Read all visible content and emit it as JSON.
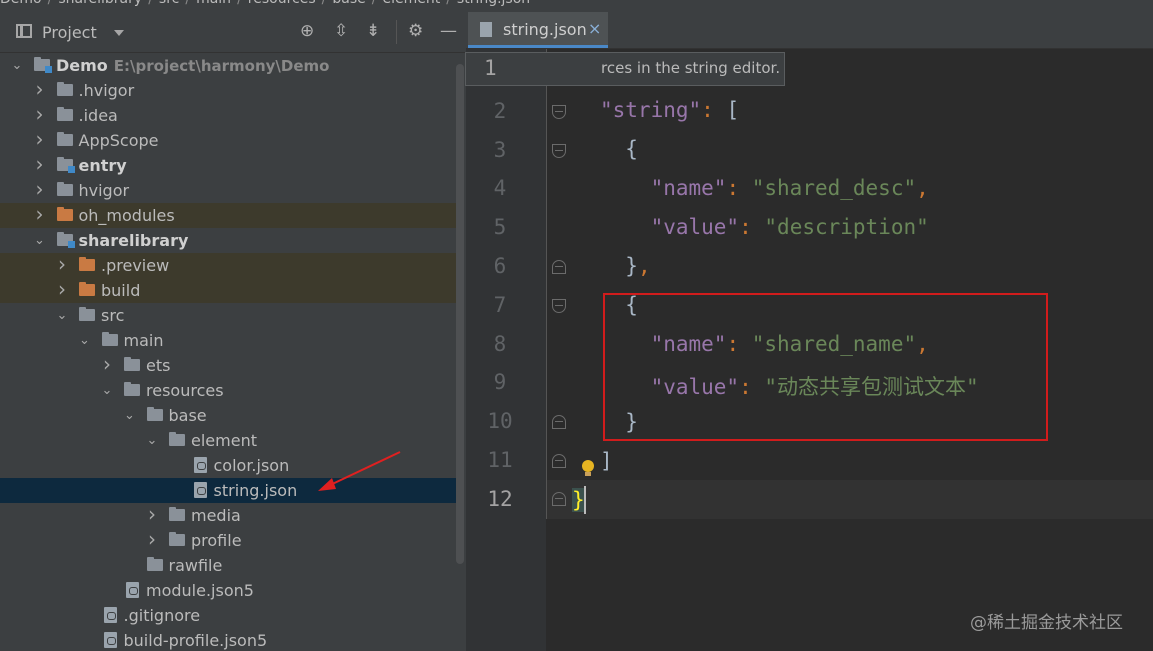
{
  "breadcrumb": [
    "Demo",
    "sharelibrary",
    "src",
    "main",
    "resources",
    "base",
    "element",
    "string.json"
  ],
  "project_panel": {
    "title": "Project",
    "tree": [
      {
        "label": "Demo",
        "path": "E:\\project\\harmony\\Demo",
        "depth": 0,
        "arrow": "open",
        "icon": "module-folder",
        "bold": true
      },
      {
        "label": ".hvigor",
        "depth": 1,
        "arrow": "closed",
        "icon": "folder"
      },
      {
        "label": ".idea",
        "depth": 1,
        "arrow": "closed",
        "icon": "folder"
      },
      {
        "label": "AppScope",
        "depth": 1,
        "arrow": "closed",
        "icon": "folder"
      },
      {
        "label": "entry",
        "depth": 1,
        "arrow": "closed",
        "icon": "module-folder",
        "bold": true
      },
      {
        "label": "hvigor",
        "depth": 1,
        "arrow": "closed",
        "icon": "folder"
      },
      {
        "label": "oh_modules",
        "depth": 1,
        "arrow": "closed",
        "icon": "orange-folder",
        "highlight": true
      },
      {
        "label": "sharelibrary",
        "depth": 1,
        "arrow": "open",
        "icon": "module-folder",
        "bold": true
      },
      {
        "label": ".preview",
        "depth": 2,
        "arrow": "closed",
        "icon": "orange-folder",
        "highlight": true
      },
      {
        "label": "build",
        "depth": 2,
        "arrow": "closed",
        "icon": "orange-folder",
        "highlight": true
      },
      {
        "label": "src",
        "depth": 2,
        "arrow": "open",
        "icon": "folder"
      },
      {
        "label": "main",
        "depth": 3,
        "arrow": "open",
        "icon": "folder"
      },
      {
        "label": "ets",
        "depth": 4,
        "arrow": "closed",
        "icon": "folder"
      },
      {
        "label": "resources",
        "depth": 4,
        "arrow": "open",
        "icon": "folder"
      },
      {
        "label": "base",
        "depth": 5,
        "arrow": "open",
        "icon": "folder"
      },
      {
        "label": "element",
        "depth": 6,
        "arrow": "open",
        "icon": "folder"
      },
      {
        "label": "color.json",
        "depth": 7,
        "arrow": "none",
        "icon": "json-file"
      },
      {
        "label": "string.json",
        "depth": 7,
        "arrow": "none",
        "icon": "json-file",
        "selected": true
      },
      {
        "label": "media",
        "depth": 6,
        "arrow": "closed",
        "icon": "folder"
      },
      {
        "label": "profile",
        "depth": 6,
        "arrow": "closed",
        "icon": "folder"
      },
      {
        "label": "rawfile",
        "depth": 5,
        "arrow": "none",
        "icon": "folder"
      },
      {
        "label": "module.json5",
        "depth": 4,
        "arrow": "none",
        "icon": "json-file"
      },
      {
        "label": ".gitignore",
        "depth": 3,
        "arrow": "none",
        "icon": "json-file"
      },
      {
        "label": "build-profile.json5",
        "depth": 3,
        "arrow": "none",
        "icon": "json-file"
      }
    ]
  },
  "editor": {
    "tab_label": "string.json",
    "tab_close": "×",
    "tooltip_text": "rces in the string editor.",
    "line_numbers": [
      "1",
      "2",
      "3",
      "4",
      "5",
      "6",
      "7",
      "8",
      "9",
      "10",
      "11",
      "12"
    ],
    "current_line": "12"
  },
  "colors": {
    "annotation_red": "#d11c1c",
    "selection": "#0d293e",
    "tab_underline": "#4a88c7"
  },
  "watermark": "@稀土掘金技术社区"
}
